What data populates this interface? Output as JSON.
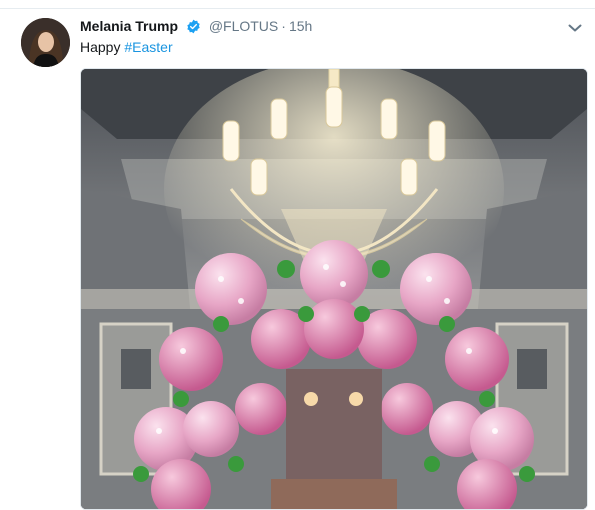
{
  "tweet": {
    "author_name": "Melania Trump",
    "handle": "@FLOTUS",
    "separator": "·",
    "timestamp": "15h",
    "text_plain": "Happy ",
    "hashtag": "#Easter"
  },
  "icons": {
    "verified": "verified-badge-icon",
    "more": "chevron-down-icon"
  },
  "colors": {
    "link": "#1b95e0",
    "verified": "#1da1f2",
    "text": "#14171a",
    "muted": "#657786"
  }
}
